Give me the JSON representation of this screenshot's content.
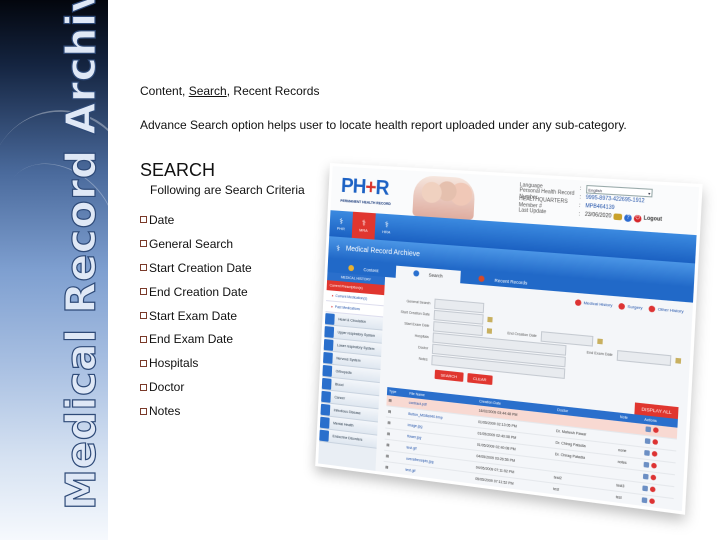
{
  "banner": {
    "title": "Medical Record Archive (MRA"
  },
  "nav_line": {
    "prefix": "Content, ",
    "active": "Search",
    "suffix": ", Recent Records"
  },
  "description": "Advance Search option helps user to locate health report uploaded under any sub-category.",
  "search": {
    "title": "SEARCH",
    "intro": "Following are Search Criteria",
    "criteria": [
      "Date",
      "General Search",
      "Start Creation Date",
      "End Creation Date",
      "Start Exam Date",
      "End Exam Date",
      "Hospitals",
      "Doctor",
      "Notes"
    ]
  },
  "screenshot": {
    "logo": {
      "left": "PH",
      "mid": "+",
      "right": "R",
      "subtitle": "PERMANENT HEALTH RECORD"
    },
    "user_info": {
      "language_label": "Language",
      "language_value": "English",
      "phr_label": "Personal Health Record Number",
      "phr_value": "9995-8973-422695-1912",
      "hq_label": "HEALTHQUARTERS Member #",
      "hq_value": "MPB464139",
      "last_update_label": "Last Update",
      "last_update_value": "23/06/2020",
      "logout": "Logout"
    },
    "top_nav": [
      {
        "label": "PHR",
        "icon": "person-icon",
        "active": false
      },
      {
        "label": "MRA",
        "icon": "archive-icon",
        "active": true
      },
      {
        "label": "HRA",
        "icon": "archive-icon",
        "active": false
      }
    ],
    "section_title": "Medical Record Archieve",
    "tabs": [
      {
        "label": "Content",
        "active": false
      },
      {
        "label": "Search",
        "active": true
      },
      {
        "label": "Recent Records",
        "active": false
      }
    ],
    "left_nav": {
      "header": "MEDICAL HISTORY",
      "sub_header": "Current Prescription(s)",
      "links": [
        "Current Medication(s)",
        "Past Medications"
      ],
      "categories": [
        "Heart & Circulation",
        "Upper respiratory System",
        "Lower respiratory System",
        "Nervous System",
        "Orthopedic",
        "Blood",
        "Cancer",
        "Infectious Disease",
        "Mental Health",
        "Endocrine Disorders"
      ]
    },
    "history_links": [
      "Medical History",
      "Surgery",
      "Other History"
    ],
    "form": {
      "general_search": "General Search",
      "start_creation_date": "Start Creation Date",
      "start_exam_date": "Start Exam Date",
      "end_creation_date": "End Creation Date",
      "end_exam_date": "End Exam Date",
      "hospitals": "Hospitals",
      "doctor": "Doctor",
      "notes": "Notes",
      "search_btn": "SEARCH",
      "clear_btn": "CLEAR"
    },
    "display_all": "DISPLAY ALL",
    "table": {
      "headers": [
        "Type",
        "File Name",
        "Creation Date",
        "Doctor",
        "Note",
        "Actions"
      ],
      "rows": [
        {
          "file": "contract.pdf",
          "date": "16/02/2009 03:44:48 PM",
          "doctor": "",
          "note": ""
        },
        {
          "file": "Button_MGBell40.bmp",
          "date": "01/05/2009 02:13:05 PM",
          "doctor": "Dr. Mahesh Pawar",
          "note": ""
        },
        {
          "file": "image.jpg",
          "date": "01/05/2009 02:40:08 PM",
          "doctor": "Dr. Chirag Patadia",
          "note": "none"
        },
        {
          "file": "flower.jpg",
          "date": "01/05/2009 02:40:08 PM",
          "doctor": "Dr. Chirag Patadia",
          "note": "notes"
        },
        {
          "file": "test.gif",
          "date": "04/05/2009 03:26:55 PM",
          "doctor": "",
          "note": ""
        },
        {
          "file": "overallreceipts.jpg",
          "date": "04/05/2009 07:11:52 PM",
          "doctor": "test2",
          "note": "test3"
        },
        {
          "file": "test.gif",
          "date": "05/05/2009 07:11:52 PM",
          "doctor": "test",
          "note": "test"
        }
      ]
    }
  }
}
